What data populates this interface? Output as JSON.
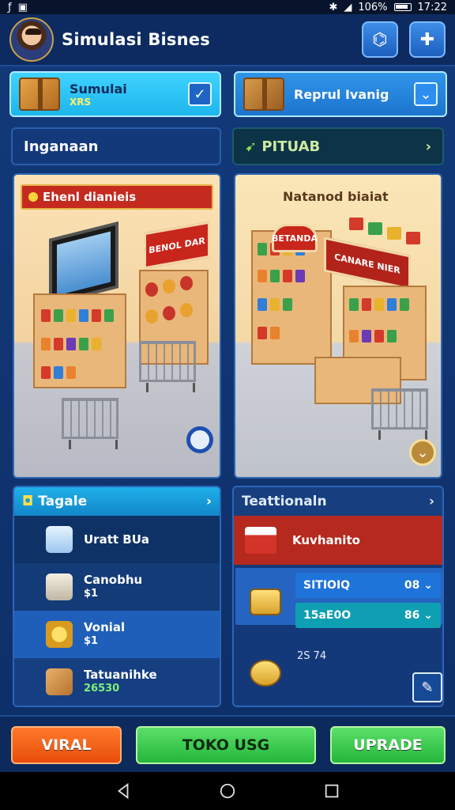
{
  "status": {
    "battery": "106%",
    "time": "17:22"
  },
  "header": {
    "title": "Simulasi Bisnes",
    "btn1_icon": "chart-icon",
    "btn2_icon": "puzzle-icon"
  },
  "selectors": [
    {
      "name": "Sumulai",
      "sub": "XRS",
      "check": "✓"
    },
    {
      "name": "Reprul Ivanig",
      "sub": "",
      "check": "⌄"
    }
  ],
  "bars": {
    "left": "Inganaan",
    "right": "PITUAB",
    "right_chev": "›"
  },
  "scene_left": {
    "banner": "Ehenl dianieis",
    "sign1": "BENOL DAR",
    "sign2": ""
  },
  "scene_right": {
    "title": "Natanod biaiat",
    "sign1": "BETANDA",
    "sign2": "CANARE NIER"
  },
  "panel_left": {
    "title": "Tagale",
    "chev": "›",
    "rows": [
      {
        "label": "Uratt BUa",
        "sub": ""
      },
      {
        "label": "Canobhu",
        "sub": "$1"
      },
      {
        "label": "Vonial",
        "sub": "$1"
      },
      {
        "label": "Tatuanihke",
        "sub": "26530"
      }
    ]
  },
  "panel_right": {
    "title": "Teattionaln",
    "chev": "›",
    "red_label": "Kuvhanito",
    "pillA": {
      "label": "SITIOIQ",
      "value": "08"
    },
    "pillB": {
      "label": "15aE0O",
      "value": "86"
    },
    "note": "2S 74"
  },
  "buttons": {
    "viral": "VIRAL",
    "toko": "TOKO USG",
    "upgrade": "UPRADE"
  },
  "colors": {
    "accent": "#1db6ec",
    "red": "#c52a1f",
    "green": "#24b63a",
    "orange": "#e84d0b"
  }
}
